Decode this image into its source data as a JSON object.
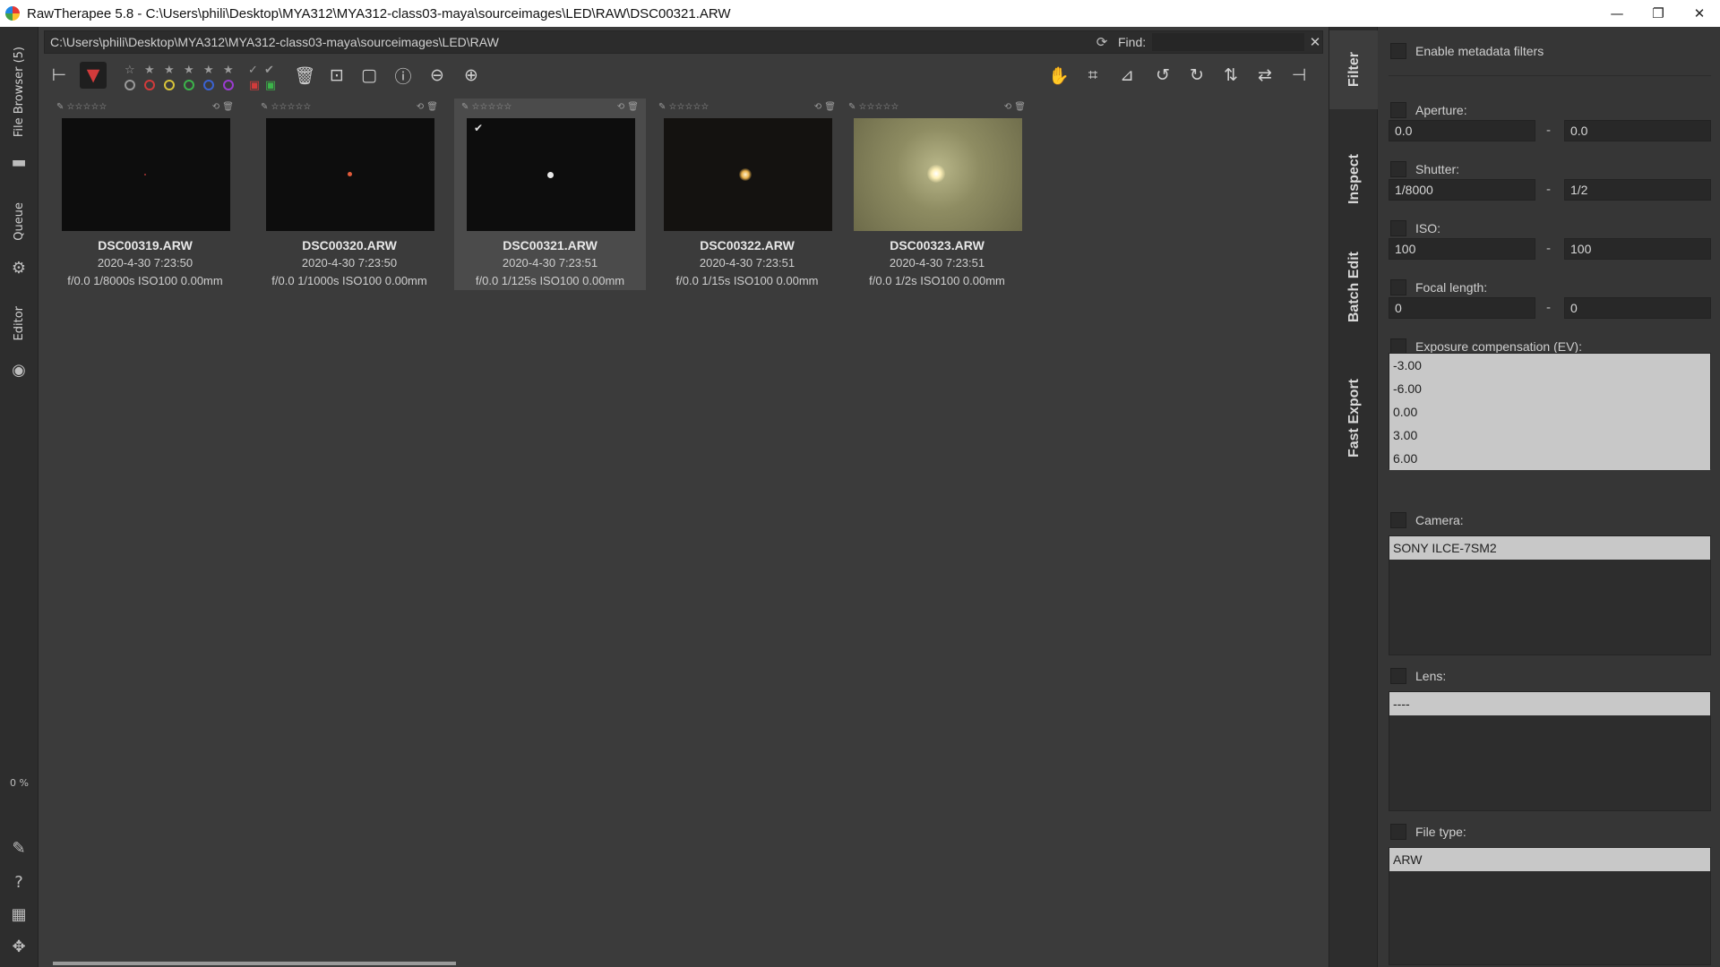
{
  "window": {
    "title": "RawTherapee 5.8 - C:\\Users\\phili\\Desktop\\MYA312\\MYA312-class03-maya\\sourceimages\\LED\\RAW\\DSC00321.ARW",
    "minimize": "—",
    "restore": "❐",
    "close": "✕"
  },
  "left_strip": {
    "file_browser": "File Browser (5)",
    "queue": "Queue",
    "editor": "Editor",
    "progress": "0 %"
  },
  "path_bar": {
    "path": "C:\\Users\\phili\\Desktop\\MYA312\\MYA312-class03-maya\\sourceimages\\LED\\RAW",
    "find_label": "Find:",
    "find_value": ""
  },
  "colors": {
    "label_red": "#d23b3b",
    "label_yellow": "#d8c43a",
    "label_green": "#3cb44a",
    "label_blue": "#3b62d2",
    "label_purple": "#9b3bd2",
    "background": "#3b3b3b"
  },
  "thumbnails": [
    {
      "name": "DSC00319.ARW",
      "date": "2020-4-30 7:23:50",
      "exif": "f/0.0 1/8000s ISO100 0.00mm"
    },
    {
      "name": "DSC00320.ARW",
      "date": "2020-4-30 7:23:50",
      "exif": "f/0.0 1/1000s ISO100 0.00mm"
    },
    {
      "name": "DSC00321.ARW",
      "date": "2020-4-30 7:23:51",
      "exif": "f/0.0 1/125s ISO100 0.00mm"
    },
    {
      "name": "DSC00322.ARW",
      "date": "2020-4-30 7:23:51",
      "exif": "f/0.0 1/15s ISO100 0.00mm"
    },
    {
      "name": "DSC00323.ARW",
      "date": "2020-4-30 7:23:51",
      "exif": "f/0.0 1/2s ISO100 0.00mm"
    }
  ],
  "right_strip": {
    "filter": "Filter",
    "inspect": "Inspect",
    "batch_edit": "Batch Edit",
    "fast_export": "Fast Export"
  },
  "filter_panel": {
    "enable_metadata": "Enable metadata filters",
    "aperture": {
      "label": "Aperture:",
      "from": "0.0",
      "to": "0.0"
    },
    "shutter": {
      "label": "Shutter:",
      "from": "1/8000",
      "to": "1/2"
    },
    "iso": {
      "label": "ISO:",
      "from": "100",
      "to": "100"
    },
    "focal_length": {
      "label": "Focal length:",
      "from": "0",
      "to": "0"
    },
    "dash": "-",
    "exposure_comp": {
      "label": "Exposure compensation (EV):",
      "items": [
        "-3.00",
        "-6.00",
        "0.00",
        "3.00",
        "6.00"
      ]
    },
    "camera": {
      "label": "Camera:",
      "items": [
        "SONY ILCE-7SM2"
      ]
    },
    "lens": {
      "label": "Lens:",
      "items": [
        "----"
      ]
    },
    "file_type": {
      "label": "File type:",
      "items": [
        "ARW"
      ]
    }
  }
}
